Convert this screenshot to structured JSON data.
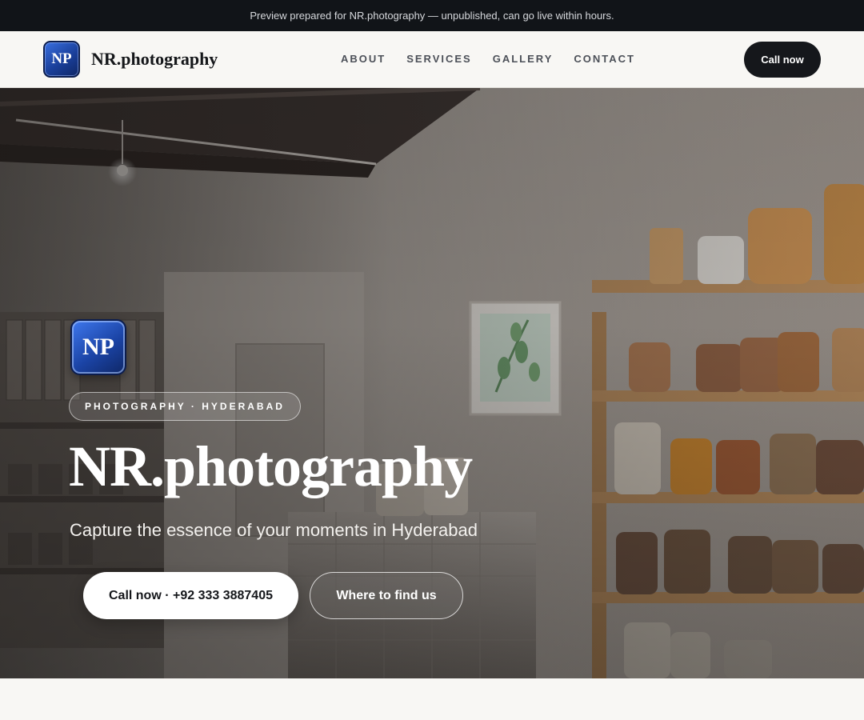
{
  "preview_banner": {
    "text": "Preview prepared for NR.photography — unpublished, can go live within hours."
  },
  "header": {
    "logo_text": "NP",
    "brand_name": "NR.photography",
    "nav": [
      {
        "label": "ABOUT"
      },
      {
        "label": "SERVICES"
      },
      {
        "label": "GALLERY"
      },
      {
        "label": "CONTACT"
      }
    ],
    "cta_label": "Call now"
  },
  "hero": {
    "logo_text": "NP",
    "kicker": "PHOTOGRAPHY · HYDERABAD",
    "title": "NR.photography",
    "subtitle": "Capture the essence of your moments in Hyderabad",
    "primary_button": "Call now · +92 333 3887405",
    "secondary_button": "Where to find us"
  },
  "colors": {
    "banner_bg": "#111418",
    "page_bg": "#f8f7f4",
    "cta_bg": "#15171b",
    "logo_blue": "#1a3f9a"
  }
}
